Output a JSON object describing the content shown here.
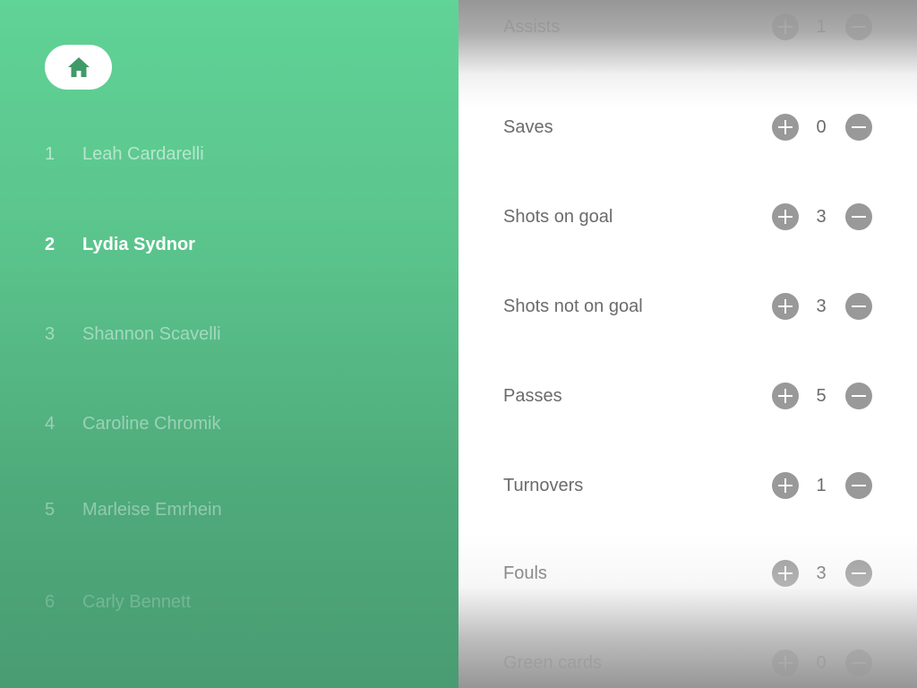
{
  "roster": {
    "home_icon": "home-icon",
    "players": [
      {
        "number": "1",
        "name": "Leah Cardarelli",
        "selected": false
      },
      {
        "number": "2",
        "name": "Lydia Sydnor",
        "selected": true
      },
      {
        "number": "3",
        "name": "Shannon Scavelli",
        "selected": false
      },
      {
        "number": "4",
        "name": "Caroline Chromik",
        "selected": false
      },
      {
        "number": "5",
        "name": "Marleise Emrhein",
        "selected": false
      },
      {
        "number": "6",
        "name": "Carly Bennett",
        "selected": false
      }
    ]
  },
  "stats": {
    "increment_icon": "plus-circle-icon",
    "decrement_icon": "minus-circle-icon",
    "rows": [
      {
        "label": "Assists",
        "value": "1"
      },
      {
        "label": "Saves",
        "value": "0"
      },
      {
        "label": "Shots on goal",
        "value": "3"
      },
      {
        "label": "Shots not on goal",
        "value": "3"
      },
      {
        "label": "Passes",
        "value": "5"
      },
      {
        "label": "Turnovers",
        "value": "1"
      },
      {
        "label": "Fouls",
        "value": "3"
      },
      {
        "label": "Green cards",
        "value": "0"
      }
    ]
  },
  "colors": {
    "panel_green": "#5bc48d",
    "home_icon_green": "#3f9a68",
    "stat_text": "#6b6b6b",
    "stat_button": "#999999"
  }
}
